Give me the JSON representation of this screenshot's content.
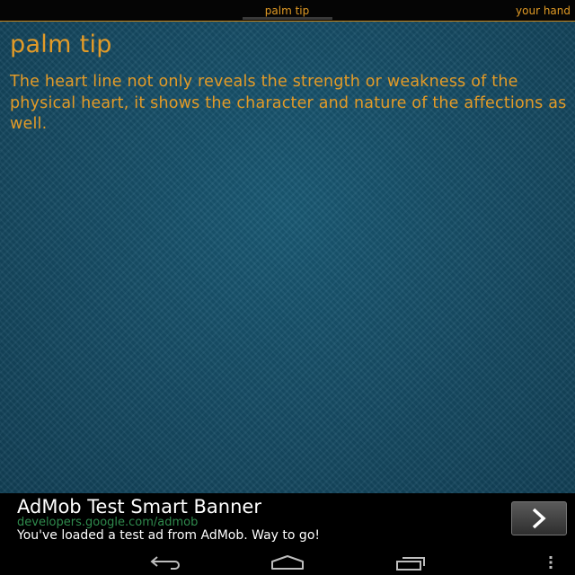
{
  "tabs": {
    "current": "palm tip",
    "next": "your hand"
  },
  "content": {
    "title": "palm tip",
    "body": "The heart line not only reveals the strength or weakness of the physical heart, it shows the character and nature of the affections as well."
  },
  "ad": {
    "title": "AdMob Test Smart Banner",
    "url": "developers.google.com/admob",
    "message": "You've loaded a test ad from AdMob. Way to go!",
    "cta_icon": "chevron-right-icon"
  },
  "navbar": {
    "back_icon": "back-icon",
    "home_icon": "home-icon",
    "recent_icon": "recent-apps-icon",
    "menu_icon": "overflow-menu-icon"
  },
  "colors": {
    "accent": "#e39b27",
    "background": "#174f68",
    "ad_url": "#2f8a4d"
  }
}
